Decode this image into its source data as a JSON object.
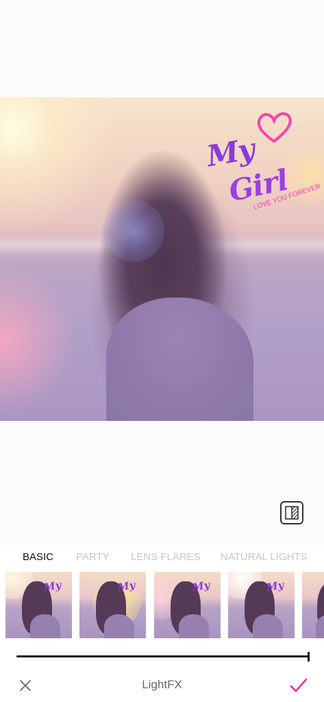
{
  "photo": {
    "sticker": {
      "line1": "My",
      "line2": "Girl",
      "tagline": "LOVE YOU FOREVER"
    }
  },
  "compare_button": {
    "icon": "compare-icon"
  },
  "tabs": [
    {
      "label": "BASIC",
      "active": true
    },
    {
      "label": "PARTY",
      "active": false
    },
    {
      "label": "LENS FLARES",
      "active": false
    },
    {
      "label": "NATURAL LIGHTS",
      "active": false
    }
  ],
  "thumbnails": [
    {
      "name": "effect-thumb-1"
    },
    {
      "name": "effect-thumb-2"
    },
    {
      "name": "effect-thumb-3"
    },
    {
      "name": "effect-thumb-4"
    },
    {
      "name": "effect-thumb-5"
    }
  ],
  "slider": {
    "value_fraction": 1.0
  },
  "bottom_bar": {
    "title": "LightFX",
    "close_icon": "close-icon",
    "confirm_icon": "checkmark-icon",
    "accent_color": "#e8228c"
  }
}
